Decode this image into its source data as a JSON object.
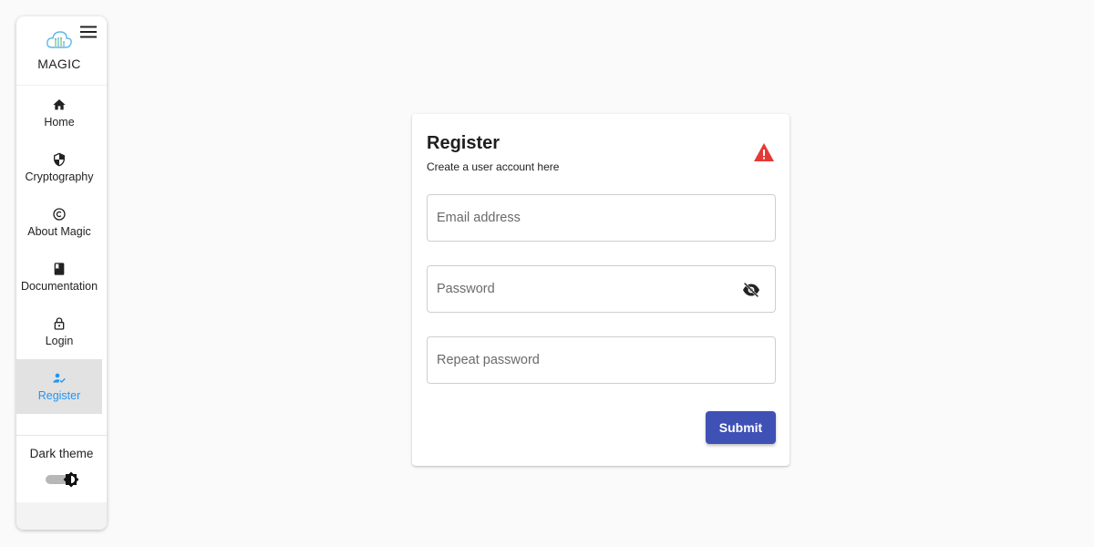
{
  "sidebar": {
    "app_name": "MAGIC",
    "logo_icon": "cloud-logo-icon",
    "menu_icon": "hamburger-menu-icon",
    "items": [
      {
        "label": "Home",
        "icon": "home-icon",
        "active": false
      },
      {
        "label": "Cryptography",
        "icon": "shield-icon",
        "active": false
      },
      {
        "label": "About Magic",
        "icon": "copyright-icon",
        "active": false
      },
      {
        "label": "Documentation",
        "icon": "book-icon",
        "active": false
      },
      {
        "label": "Login",
        "icon": "lock-open-icon",
        "active": false
      },
      {
        "label": "Register",
        "icon": "person-check-icon",
        "active": true
      }
    ],
    "theme": {
      "label": "Dark theme",
      "enabled": false,
      "icon": "brightness-icon"
    }
  },
  "form": {
    "title": "Register",
    "subtitle": "Create a user account here",
    "status_icon": "warning-icon",
    "email_placeholder": "Email address",
    "password_placeholder": "Password",
    "repeat_placeholder": "Repeat password",
    "visibility_icon": "visibility-off-icon",
    "submit_label": "Submit"
  },
  "colors": {
    "active_nav_text": "#2196f3",
    "active_nav_background": "#e2e2e2",
    "primary_button": "#3f51b5",
    "warning": "#e53935",
    "page_background": "#fafafa"
  }
}
